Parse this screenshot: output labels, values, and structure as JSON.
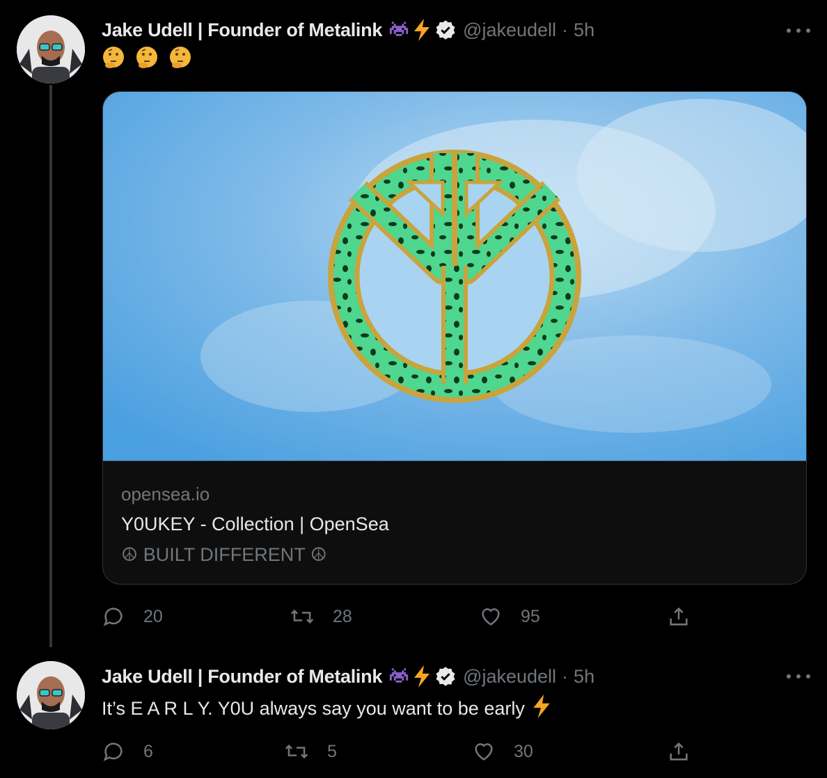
{
  "tweets": [
    {
      "author_name": "Jake Udell | Founder of Metalink",
      "handle": "@jakeudell",
      "separator": "·",
      "time": "5h",
      "text_emojis": [
        "🤔",
        "🤔",
        "🤔"
      ],
      "card": {
        "domain": "opensea.io",
        "title": "Y0UKEY - Collection | OpenSea",
        "description": "☮ BUILT DIFFERENT ☮"
      },
      "replies": "20",
      "retweets": "28",
      "likes": "95"
    },
    {
      "author_name": "Jake Udell | Founder of Metalink",
      "handle": "@jakeudell",
      "separator": "·",
      "time": "5h",
      "text": "It’s E A R L Y. Y0U always say you want to be early",
      "text_emoji": "⚡",
      "replies": "6",
      "retweets": "5",
      "likes": "30"
    }
  ],
  "colors": {
    "background": "#000000",
    "name": "#e7e9ea",
    "secondary": "#71767b",
    "sky": "#5aa8e2",
    "logo_green": "#4fd68f",
    "logo_gold": "#c9a43c"
  },
  "icons": [
    "space-invader-icon",
    "lightning-icon",
    "verified-badge-icon",
    "more-icon",
    "reply-icon",
    "retweet-icon",
    "like-icon",
    "share-icon"
  ]
}
